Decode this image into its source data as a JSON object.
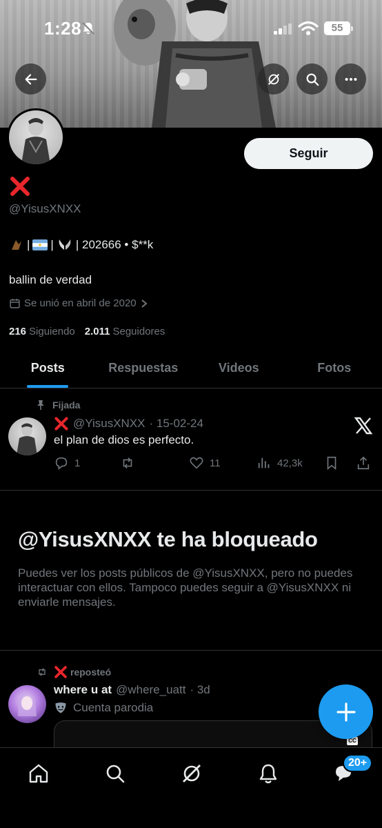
{
  "status_bar": {
    "time": "1:28",
    "battery": "55"
  },
  "profile": {
    "name_emoji": "❌",
    "handle": "@YisusXNXX",
    "bio_line1_text": "| 202666 • $**k",
    "bio_line2": "ballin de verdad",
    "joined": "Se unió en abril de 2020",
    "following_count": "216",
    "following_label": "Siguiendo",
    "followers_count": "2.011",
    "followers_label": "Seguidores",
    "follow_button": "Seguir"
  },
  "tabs": [
    {
      "label": "Posts",
      "active": true
    },
    {
      "label": "Respuestas",
      "active": false
    },
    {
      "label": "Videos",
      "active": false
    },
    {
      "label": "Fotos",
      "active": false
    }
  ],
  "pinned_post": {
    "pinned_label": "Fijada",
    "author_handle": "@YisusXNXX",
    "date": "· 15-02-24",
    "text": "el plan de dios es perfecto.",
    "replies": "1",
    "reposts": "",
    "likes": "11",
    "views": "42,3k"
  },
  "blocked": {
    "title": "@YisusXNXX te ha bloqueado",
    "description": "Puedes ver los posts públicos de @YisusXNXX, pero no puedes interactuar con ellos. Tampoco puedes seguir a @YisusXNXX ni enviarle mensajes."
  },
  "repost": {
    "label": "reposteó",
    "author_name": "where u at",
    "author_handle": "@where_uatt",
    "time": "· 3d",
    "parody_label": "Cuenta parodia",
    "cc": "CC"
  },
  "bottom_nav": {
    "notifications_badge": "20+"
  },
  "colors": {
    "accent": "#1d9bf0",
    "background": "#000000",
    "muted": "#71767b",
    "text": "#e7e9ea"
  }
}
